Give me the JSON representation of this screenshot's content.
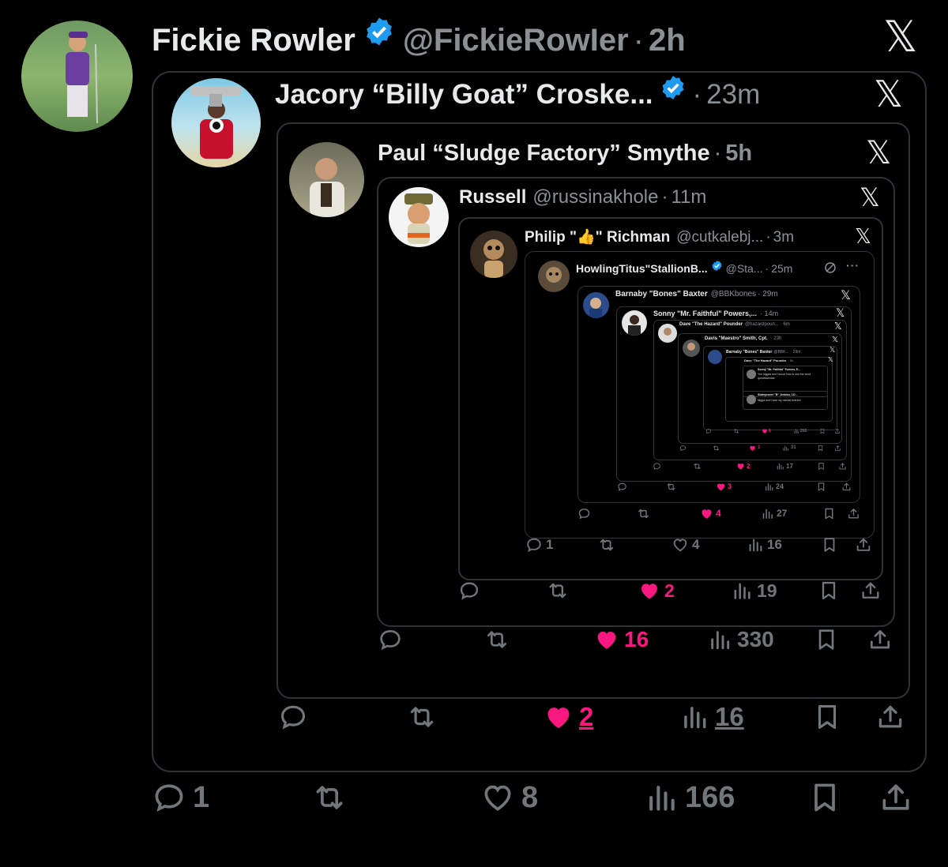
{
  "colors": {
    "bg": "#000000",
    "text": "#e7e9ea",
    "muted": "#71767b",
    "like": "#f91880",
    "verified": "#1d9bf0",
    "border": "#2f3336"
  },
  "l0": {
    "name": "Fickie Rowler",
    "handle": "@FickieRowIer",
    "sep": "·",
    "time": "2h",
    "reply": "1",
    "like": "8",
    "views": "166"
  },
  "l1": {
    "name": "Jacory “Billy Goat” Croske...",
    "sep": "·",
    "time": "23m",
    "like": "2",
    "views": "16"
  },
  "l2": {
    "name": "Paul “Sludge Factory” Smythe",
    "sep": "·",
    "time": "5h",
    "like": "16",
    "views": "330"
  },
  "l3": {
    "name": "Russell",
    "handle": "@russinakhole",
    "sep": "·",
    "time": "11m",
    "like": "2",
    "views": "19"
  },
  "l4": {
    "name_a": "Philip \"",
    "emoji": "👍",
    "name_b": "\" Richman",
    "handle": "@cutkalebj...",
    "sep": "·",
    "time": "3m",
    "reply": "1",
    "like": "4",
    "views": "16"
  },
  "l5": {
    "name": "HowlingTitus\"StallionB...",
    "handle": "@Sta...",
    "sep": "·",
    "time": "25m",
    "like": "4",
    "views": "27"
  },
  "l6": {
    "name": "Barnaby \"Bones\" Baxter",
    "handle": "@BBKbones",
    "time": "· 29m",
    "like": "3",
    "views": "24"
  },
  "l7": {
    "name": "Sonny \"Mr. Faithful\" Powers,...",
    "time": "· 14m",
    "like": "2",
    "views": "17"
  },
  "l8": {
    "name": "Dave \"The Hazard\" Pounder",
    "handle": "@hazardpoun...",
    "time": "· 6m",
    "like": "1",
    "views": "31"
  },
  "l9": {
    "name": "Davis \"Maestro\" Smith, Cpt.",
    "time": "· 23h",
    "like": "8",
    "views": "202"
  },
  "l10": {
    "name": "Barnaby \"Bones\" Baxter",
    "handle": "@BBK...",
    "time": "· 29m"
  },
  "l11": {
    "name": "Dave \"The Hazard\" Pounder",
    "time": "· 6h"
  },
  "l12": {
    "name": "Sonny \"Mr. Faithful\" Powers, E...",
    "text": "You niggas don't know how to use the word quintessential"
  },
  "l13": {
    "name": "Skateprover \"B\" Jenkins, LD...",
    "text": "Nigga don't lose my mental bracket"
  },
  "icons": {
    "x": "𝕏",
    "reply": "reply-icon",
    "retweet": "retweet-icon",
    "like": "heart-icon",
    "views": "views-icon",
    "bookmark": "bookmark-icon",
    "share": "share-icon"
  }
}
